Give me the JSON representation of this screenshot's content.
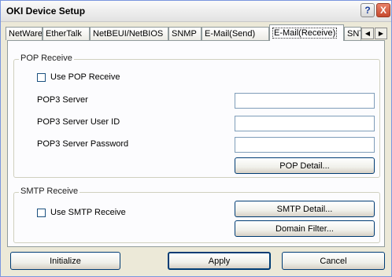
{
  "window": {
    "title": "OKI Device Setup",
    "help_glyph": "?",
    "close_glyph": "X"
  },
  "tabs": [
    {
      "label": "NetWare"
    },
    {
      "label": "EtherTalk"
    },
    {
      "label": "NetBEUI/NetBIOS"
    },
    {
      "label": "SNMP"
    },
    {
      "label": "E-Mail(Send)"
    },
    {
      "label": "E-Mail(Receive)"
    },
    {
      "label": "SNTI"
    }
  ],
  "tab_scroll": {
    "left_glyph": "◀",
    "right_glyph": "▶"
  },
  "pop": {
    "legend": "POP Receive",
    "use_label": "Use POP Receive",
    "use_checked": false,
    "server_label": "POP3 Server",
    "server_value": "",
    "userid_label": "POP3 Server User ID",
    "userid_value": "",
    "password_label": "POP3 Server Password",
    "password_value": "",
    "detail_button": "POP Detail..."
  },
  "smtp": {
    "legend": "SMTP Receive",
    "use_label": "Use SMTP Receive",
    "use_checked": false,
    "detail_button": "SMTP Detail...",
    "domain_button": "Domain Filter..."
  },
  "footer": {
    "initialize": "Initialize",
    "apply": "Apply",
    "cancel": "Cancel"
  }
}
